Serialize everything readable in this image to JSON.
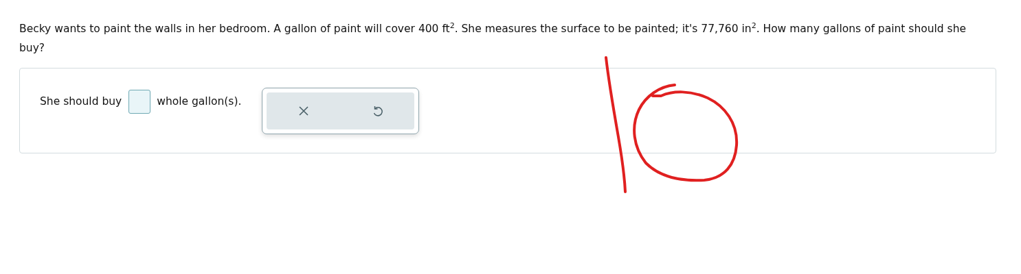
{
  "question": {
    "text": "Becky wants to paint the walls in her bedroom. A gallon of paint will cover 400 ft$^{2}$. She measures the surface to be painted; it's 77,760 in$^{2}$. How many gallons of paint should she buy?"
  },
  "answer": {
    "before": "She should buy",
    "after": "whole gallon(s)."
  },
  "tools": [
    {
      "kind": "clear"
    },
    {
      "kind": "undo"
    }
  ]
}
